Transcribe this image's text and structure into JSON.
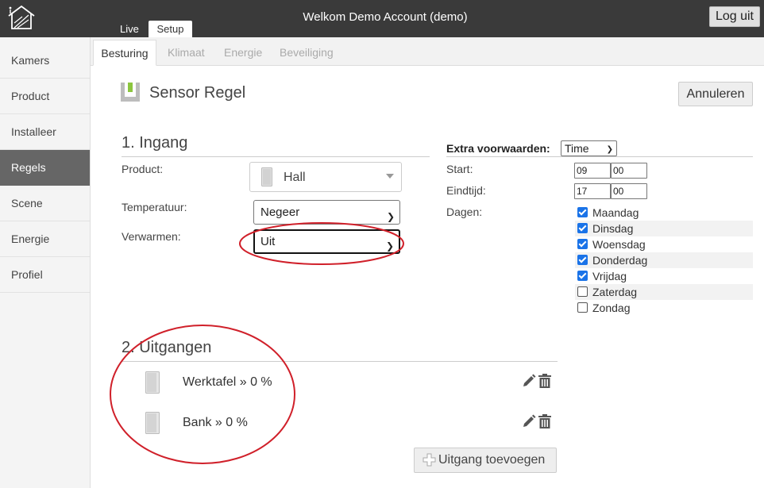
{
  "header": {
    "title": "Welkom Demo Account (demo)",
    "logout_label": "Log uit",
    "tabs": [
      {
        "label": "Live"
      },
      {
        "label": "Setup"
      }
    ]
  },
  "sidebar": {
    "items": [
      {
        "label": "Kamers"
      },
      {
        "label": "Product"
      },
      {
        "label": "Installeer"
      },
      {
        "label": "Regels",
        "active": true
      },
      {
        "label": "Scene"
      },
      {
        "label": "Energie"
      },
      {
        "label": "Profiel"
      }
    ]
  },
  "subtabs": [
    {
      "label": "Besturing",
      "active": true
    },
    {
      "label": "Klimaat"
    },
    {
      "label": "Energie"
    },
    {
      "label": "Beveiliging"
    }
  ],
  "page": {
    "title": "Sensor Regel",
    "cancel_label": "Annuleren"
  },
  "ingang": {
    "title": "1. Ingang",
    "product_label": "Product:",
    "product_value": "Hall",
    "temp_label": "Temperatuur:",
    "temp_value": "Negeer",
    "heat_label": "Verwarmen:",
    "heat_value": "Uit"
  },
  "extra": {
    "label": "Extra voorwaarden:",
    "type_value": "Time",
    "start_label": "Start:",
    "start_hour": "09",
    "start_min": "00",
    "end_label": "Eindtijd:",
    "end_hour": "17",
    "end_min": "00",
    "days_label": "Dagen:",
    "days": [
      {
        "label": "Maandag",
        "checked": true
      },
      {
        "label": "Dinsdag",
        "checked": true
      },
      {
        "label": "Woensdag",
        "checked": true
      },
      {
        "label": "Donderdag",
        "checked": true
      },
      {
        "label": "Vrijdag",
        "checked": true
      },
      {
        "label": "Zaterdag",
        "checked": false
      },
      {
        "label": "Zondag",
        "checked": false
      }
    ]
  },
  "uitgangen": {
    "title": "2. Uitgangen",
    "items": [
      {
        "label": "Werktafel » 0 %"
      },
      {
        "label": "Bank » 0 %"
      }
    ],
    "add_label": "Uitgang toevoegen"
  },
  "colors": {
    "header_bg": "#3a3a3a",
    "sidebar_active": "#666666",
    "checkbox": "#1a73e8",
    "annotation": "#d0202a",
    "rule_icon_accent": "#8cc63f"
  }
}
